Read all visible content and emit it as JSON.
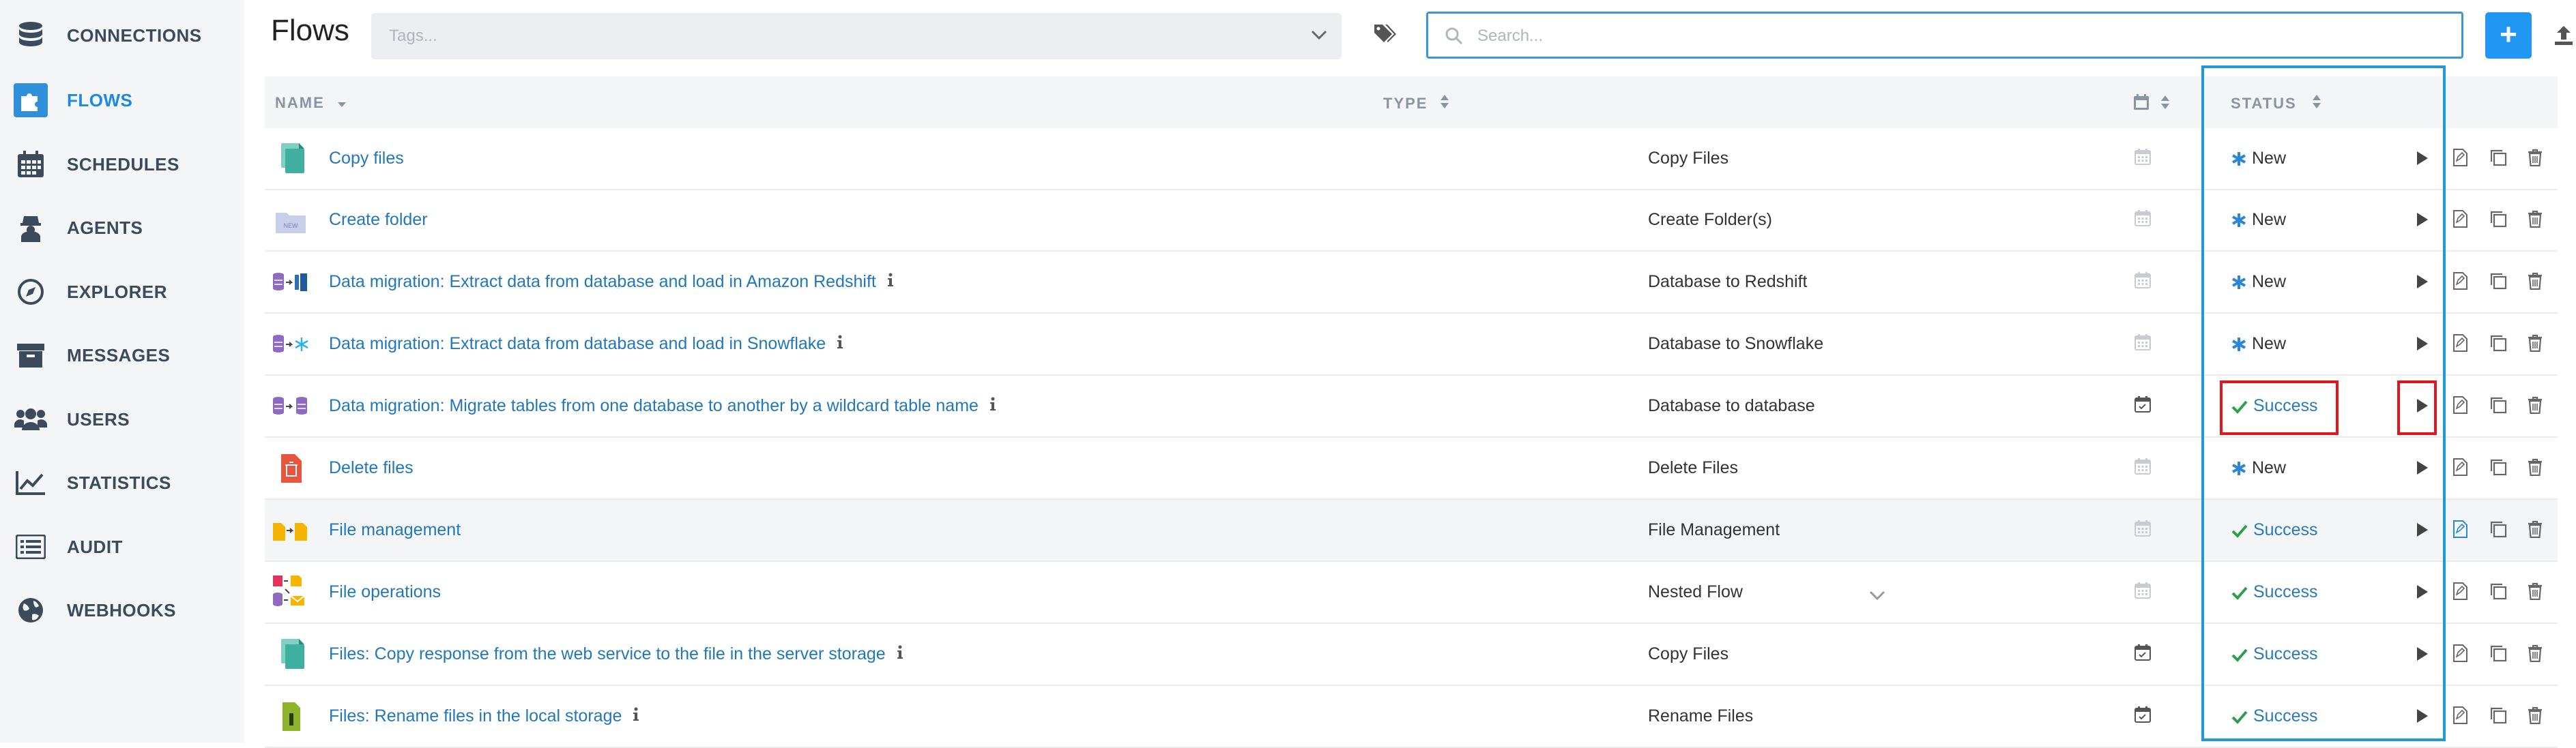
{
  "sidebar": {
    "items": [
      {
        "label": "CONNECTIONS",
        "icon": "database-icon",
        "active": false
      },
      {
        "label": "FLOWS",
        "icon": "puzzle-icon",
        "active": true
      },
      {
        "label": "SCHEDULES",
        "icon": "calendar-icon",
        "active": false
      },
      {
        "label": "AGENTS",
        "icon": "agent-icon",
        "active": false
      },
      {
        "label": "EXPLORER",
        "icon": "compass-icon",
        "active": false
      },
      {
        "label": "MESSAGES",
        "icon": "archive-icon",
        "active": false
      },
      {
        "label": "USERS",
        "icon": "users-icon",
        "active": false
      },
      {
        "label": "STATISTICS",
        "icon": "line-chart-icon",
        "active": false
      },
      {
        "label": "AUDIT",
        "icon": "list-icon",
        "active": false
      },
      {
        "label": "WEBHOOKS",
        "icon": "globe-icon",
        "active": false
      }
    ]
  },
  "header": {
    "title": "Flows",
    "tags_placeholder": "Tags...",
    "search_placeholder": "Search...",
    "add_label": "+"
  },
  "table": {
    "columns": {
      "name": "NAME",
      "type": "TYPE",
      "status": "STATUS"
    },
    "rows": [
      {
        "name": "Copy files",
        "type": "Copy Files",
        "status": "New",
        "info": false,
        "icon": "copy-files-icon"
      },
      {
        "name": "Create folder",
        "type": "Create Folder(s)",
        "status": "New",
        "info": false,
        "icon": "create-folder-icon"
      },
      {
        "name": "Data migration: Extract data from database and load in Amazon Redshift",
        "type": "Database to Redshift",
        "status": "New",
        "info": true,
        "icon": "db-to-redshift-icon"
      },
      {
        "name": "Data migration: Extract data from database and load in Snowflake",
        "type": "Database to Snowflake",
        "status": "New",
        "info": true,
        "icon": "db-to-snowflake-icon"
      },
      {
        "name": "Data migration: Migrate tables from one database to another by a wildcard table name",
        "type": "Database to database",
        "status": "Success",
        "info": true,
        "icon": "db-to-db-icon"
      },
      {
        "name": "Delete files",
        "type": "Delete Files",
        "status": "New",
        "info": false,
        "icon": "delete-files-icon"
      },
      {
        "name": "File management",
        "type": "File Management",
        "status": "Success",
        "info": false,
        "icon": "file-management-icon"
      },
      {
        "name": "File operations",
        "type": "Nested Flow",
        "status": "Success",
        "info": false,
        "icon": "nested-flow-icon"
      },
      {
        "name": "Files: Copy response from the web service to the file in the server storage",
        "type": "Copy Files",
        "status": "Success",
        "info": true,
        "icon": "copy-files-icon"
      },
      {
        "name": "Files: Rename files in the local storage",
        "type": "Rename Files",
        "status": "Success",
        "info": true,
        "icon": "rename-files-icon"
      }
    ]
  },
  "colors": {
    "accent": "#1e88e5",
    "link": "#2277bb",
    "success": "#2e9e4e",
    "new": "#2b86d6",
    "highlight_blue": "#1e9ad6",
    "highlight_red": "#e0151e"
  }
}
